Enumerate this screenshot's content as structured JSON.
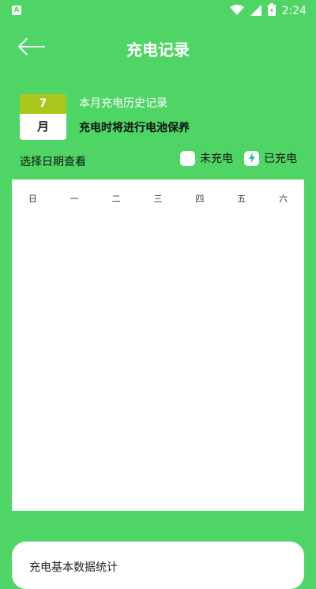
{
  "status_bar": {
    "left_icon_letter": "A",
    "time": "2:24",
    "icons": [
      "android-notification-icon",
      "wifi-icon",
      "signal-icon",
      "battery-charging-icon"
    ]
  },
  "header": {
    "title": "充电记录",
    "back_icon": "back-arrow-icon"
  },
  "badge": {
    "month_number": "7",
    "month_char": "月"
  },
  "info": {
    "history_title": "本月充电历史记录",
    "maintenance_note": "充电时将进行电池保养"
  },
  "filter": {
    "select_date_label": "选择日期查看",
    "legend": [
      {
        "label": "未充电",
        "icon": "empty-box-icon"
      },
      {
        "label": "已充电",
        "icon": "lightning-icon",
        "accent": "#2bbf9f"
      }
    ]
  },
  "calendar": {
    "weekdays": [
      "日",
      "一",
      "二",
      "三",
      "四",
      "五",
      "六"
    ]
  },
  "bottom_card": {
    "title": "充电基本数据统计"
  },
  "colors": {
    "background": "#4fd566",
    "badge_top": "#a8c71a",
    "card": "#ffffff"
  }
}
